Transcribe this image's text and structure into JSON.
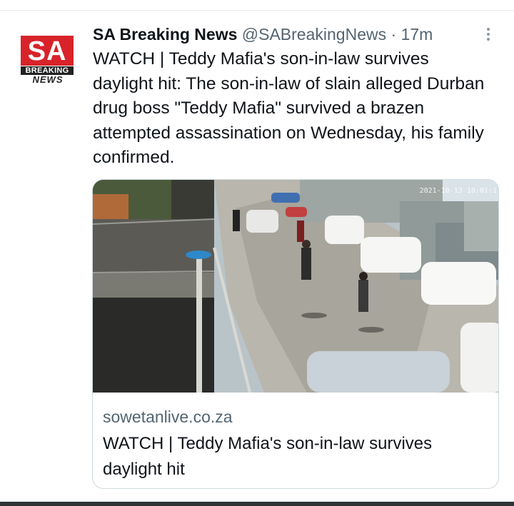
{
  "tweet": {
    "display_name": "SA Breaking News",
    "handle": "@SABreakingNews",
    "separator": "·",
    "time": "17m",
    "text": "WATCH | Teddy Mafia's son-in-law survives daylight hit: The son-in-law of slain alleged Durban drug boss \"Teddy Mafia\" survived a brazen attempted assassination on Wednesday, his family confirmed."
  },
  "avatar": {
    "top": "SA",
    "middle": "BREAKING",
    "bottom": "NEWS"
  },
  "card": {
    "video_timestamp": "2021-10-13 10:01:1",
    "domain": "sowetanlive.co.za",
    "title": "WATCH | Teddy Mafia's son-in-law survives daylight hit"
  },
  "icons": {
    "more": "more-options-icon"
  },
  "colors": {
    "logo_red": "#d8232a",
    "secondary_text": "#536471",
    "border": "#cfd9de"
  }
}
